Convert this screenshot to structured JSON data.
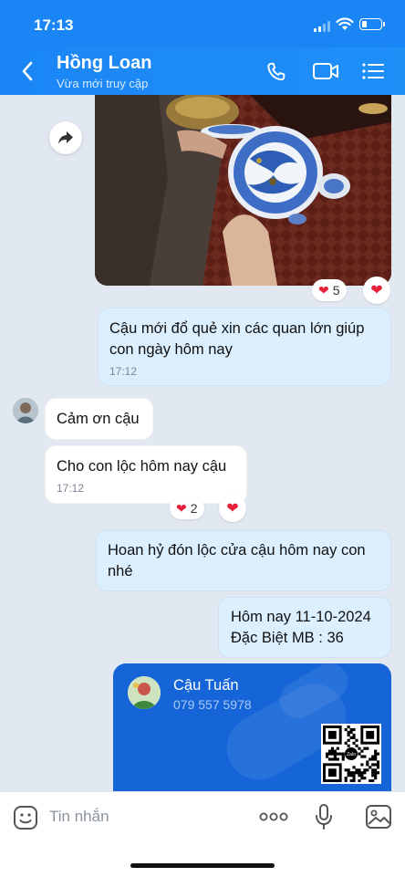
{
  "status_bar": {
    "time": "17:13"
  },
  "header": {
    "name": "Hồng Loan",
    "status": "Vừa mới truy cập"
  },
  "photo_reactions": {
    "heart": "❤",
    "count": "5"
  },
  "messages": [
    {
      "text": "Cậu mới đổ quẻ xin các quan lớn giúp con ngày hôm nay",
      "time": "17:12"
    },
    {
      "text": "Cảm ơn cậu"
    },
    {
      "text": "Cho con lộc hôm nay cậu",
      "time": "17:12",
      "reaction_heart": "❤",
      "reaction_count": "2"
    },
    {
      "text": "Hoan hỷ đón lộc cửa cậu hôm nay con nhé"
    },
    {
      "line1": "Hôm nay 11-10-2024",
      "line2": "Đặc Biệt MB : 36"
    }
  ],
  "contact_card": {
    "name": "Cậu Tuấn",
    "phone": "079 557 5978",
    "qr_logo": "Zalo"
  },
  "composer": {
    "placeholder": "Tin nhắn"
  },
  "colors": {
    "header": "#1a86f6",
    "outgoing_bubble": "#dbefff",
    "card": "#1565d8",
    "heart": "#e8213a"
  },
  "icons": [
    "back-arrow-icon",
    "phone-icon",
    "video-icon",
    "menu-list-icon",
    "forward-icon",
    "heart-icon",
    "sticker-icon",
    "more-icon",
    "microphone-icon",
    "image-icon"
  ]
}
